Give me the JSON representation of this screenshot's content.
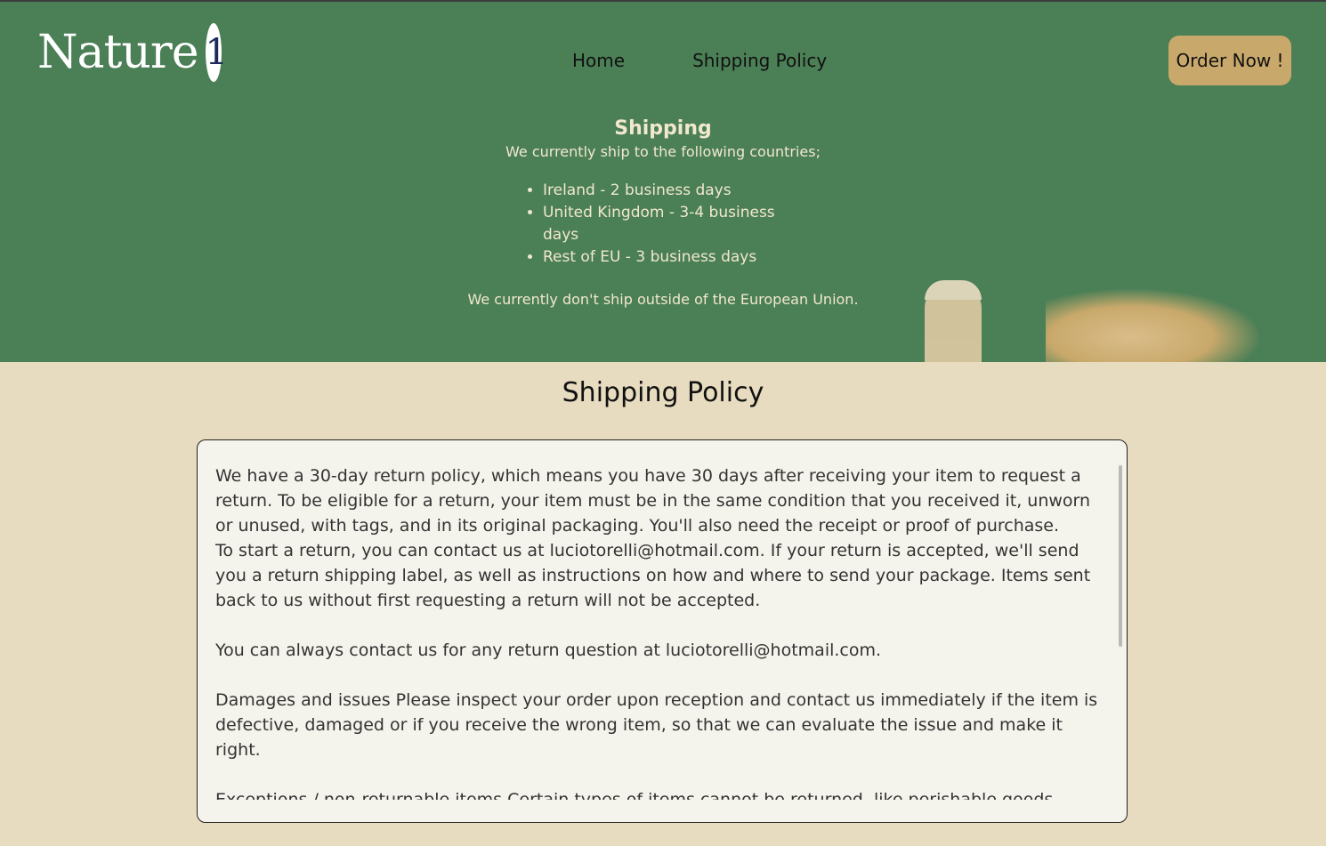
{
  "brand": {
    "name": "Nature",
    "badge": "1"
  },
  "nav": {
    "items": [
      {
        "label": "Home"
      },
      {
        "label": "Shipping Policy"
      }
    ],
    "order_button": "Order Now !"
  },
  "hero": {
    "title": "Shipping",
    "subtitle": "We currently ship to the following countries;",
    "countries": [
      "Ireland - 2 business days",
      "United Kingdom - 3-4 business days",
      "Rest of EU - 3 business days"
    ],
    "note": "We currently don't ship outside of the European Union."
  },
  "policy": {
    "heading": "Shipping Policy",
    "paragraphs": [
      "We have a 30-day return policy, which means you have 30 days after receiving your item to request a return. To be eligible for a return, your item must be in the same condition that you received it, unworn or unused, with tags, and in its original packaging. You'll also need the receipt or proof of purchase.",
      "To start a return, you can contact us at luciotorelli@hotmail.com. If your return is accepted, we'll send you a return shipping label, as well as instructions on how and where to send your package. Items sent back to us without first requesting a return will not be accepted.",
      "You can always contact us for any return question at luciotorelli@hotmail.com.",
      "Damages and issues Please inspect your order upon reception and contact us immediately if the item is defective, damaged or if you receive the wrong item, so that we can evaluate the issue and make it right.",
      "Exceptions / non-returnable items Certain types of items cannot be returned, like perishable goods (such as food, flowers, or plants), custom products (such as special orders or personalized items), and personal care"
    ]
  },
  "colors": {
    "hero_bg": "#4b7f56",
    "page_bg": "#e7dcc0",
    "accent": "#c9a96b",
    "hero_text": "#f1e8ce"
  }
}
